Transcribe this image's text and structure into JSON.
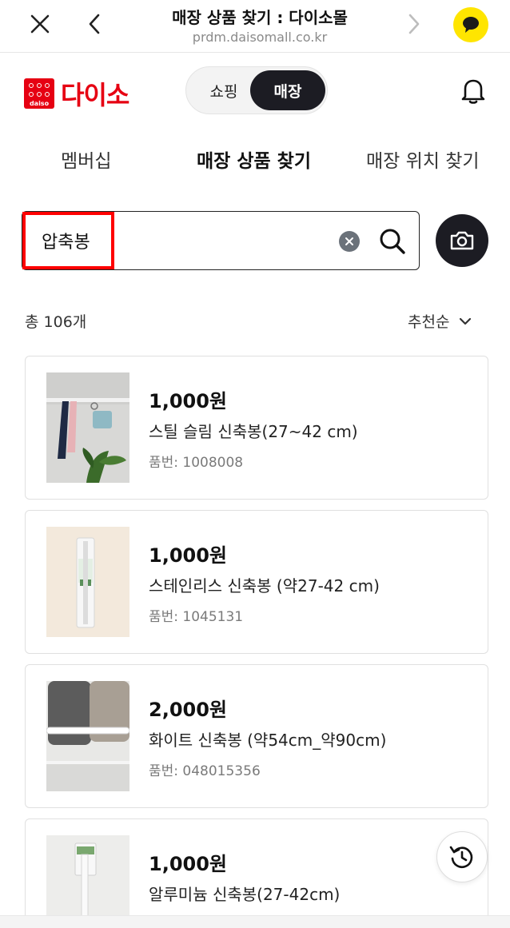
{
  "browser": {
    "title": "매장 상품 찾기 : 다이소몰",
    "url": "prdm.daisomall.co.kr"
  },
  "header": {
    "logo_small": "daiso",
    "logo_text": "다이소",
    "toggle": {
      "shopping": "쇼핑",
      "store": "매장",
      "active": "store"
    }
  },
  "tabs": [
    {
      "label": "멤버십"
    },
    {
      "label": "매장 상품 찾기",
      "active": true
    },
    {
      "label": "매장 위치 찾기"
    }
  ],
  "search": {
    "value": "압축봉",
    "highlight_color": "#ff0000"
  },
  "results": {
    "count_label": "총 106개",
    "sort_label": "추천순"
  },
  "products": [
    {
      "price": "1,000원",
      "name": "스틸 슬림 신축봉(27~42 cm)",
      "code": "품번: 1008008",
      "image": "umbrellas-on-rod"
    },
    {
      "price": "1,000원",
      "name": "스테인리스 신축봉 (약27-42 cm)",
      "code": "품번: 1045131",
      "image": "packaged-rod"
    },
    {
      "price": "2,000원",
      "name": "화이트 신축봉 (약54cm_약90cm)",
      "code": "품번: 048015356",
      "image": "towels-on-rod"
    },
    {
      "price": "1,000원",
      "name": "알루미늄 신축봉(27-42cm)",
      "code": "",
      "image": "packaged-rod-white"
    }
  ],
  "colors": {
    "brand_red": "#e60012",
    "dark": "#1c1c23",
    "kakao_yellow": "#ffe500"
  }
}
